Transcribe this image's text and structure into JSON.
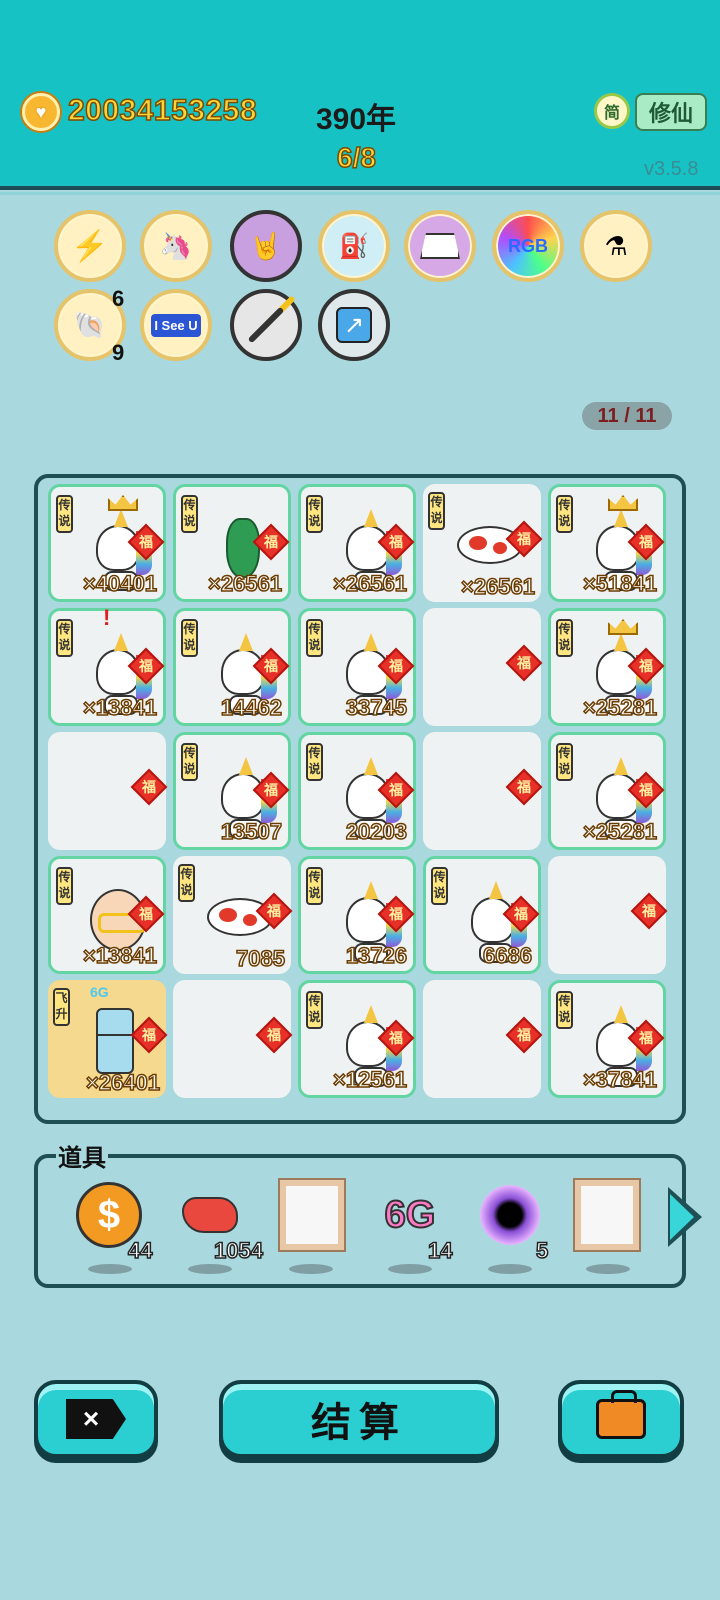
{
  "header": {
    "money": "20034153258",
    "year": "390年",
    "stage": "6/8",
    "simp_label": "简",
    "mode_label": "修仙",
    "version": "v3.5.8"
  },
  "badges": {
    "row1": [
      {
        "name": "lightning-badge",
        "icon": "⚡",
        "bg": "#fff1c2"
      },
      {
        "name": "unicorn-badge",
        "icon": "🦄",
        "bg": "#fff1c2"
      },
      {
        "name": "rock-hand-badge",
        "icon": "🤘",
        "bg": "#c8a0e0"
      },
      {
        "name": "pump-badge",
        "icon": "⛽",
        "bg": "#cfeef5"
      },
      {
        "name": "skirt-badge",
        "icon": "👗",
        "bg": "#d6a8e6"
      },
      {
        "name": "rgb-badge",
        "icon": "RGB",
        "bg": "#ff5f5f"
      },
      {
        "name": "potion-badge",
        "icon": "⚗",
        "bg": "#fff1c2"
      }
    ],
    "row2": [
      {
        "name": "shell-badge",
        "icon": "🐚",
        "bg": "#fff1c2"
      },
      {
        "name": "i-see-u-badge",
        "icon": "I See U",
        "bg": "#fff1c2"
      },
      {
        "name": "screwdriver-badge",
        "icon": "🪛",
        "bg": "#e6e6e6"
      },
      {
        "name": "arrow-badge",
        "icon": "↗",
        "bg": "#dfe8ea"
      }
    ],
    "shell_sup_top": "6",
    "shell_sup_bottom": "9"
  },
  "counter": "11 / 11",
  "board": {
    "tag_legend": "传说",
    "tag_ascend": "飞升",
    "fu": "福",
    "rows": [
      [
        {
          "item": "unicorn-crown",
          "count": "×40401",
          "tag": "传说",
          "filled": true
        },
        {
          "item": "vase",
          "count": "×26561",
          "tag": "传说",
          "filled": true
        },
        {
          "item": "unicorn",
          "count": "×26561",
          "tag": "传说",
          "filled": true
        },
        {
          "item": "fish",
          "count": "×26561",
          "tag": "传说",
          "filled": false
        },
        {
          "item": "unicorn-crown",
          "count": "×51841",
          "tag": "传说",
          "filled": true
        }
      ],
      [
        {
          "item": "unicorn-alert",
          "count": "×13841",
          "tag": "传说",
          "filled": true
        },
        {
          "item": "unicorn",
          "count": "14462",
          "tag": "传说",
          "filled": true
        },
        {
          "item": "unicorn",
          "count": "33745",
          "tag": "传说",
          "filled": true
        },
        {
          "item": "empty",
          "count": "",
          "tag": "",
          "filled": false
        },
        {
          "item": "unicorn-crown",
          "count": "×25281",
          "tag": "传说",
          "filled": true
        }
      ],
      [
        {
          "item": "empty",
          "count": "",
          "tag": "",
          "filled": false
        },
        {
          "item": "unicorn",
          "count": "13507",
          "tag": "传说",
          "filled": true
        },
        {
          "item": "unicorn",
          "count": "20203",
          "tag": "传说",
          "filled": true
        },
        {
          "item": "empty",
          "count": "",
          "tag": "",
          "filled": false
        },
        {
          "item": "unicorn",
          "count": "×25281",
          "tag": "传说",
          "filled": true
        }
      ],
      [
        {
          "item": "oldman",
          "count": "×13841",
          "tag": "传说",
          "filled": true
        },
        {
          "item": "fish",
          "count": "7085",
          "tag": "传说",
          "filled": false
        },
        {
          "item": "unicorn",
          "count": "13726",
          "tag": "传说",
          "filled": true
        },
        {
          "item": "unicorn",
          "count": "6686",
          "tag": "传说",
          "filled": true
        },
        {
          "item": "empty",
          "count": "",
          "tag": "",
          "filled": false
        }
      ],
      [
        {
          "item": "fridge",
          "count": "×26401",
          "tag": "飞升",
          "filled": false,
          "gold": true
        },
        {
          "item": "empty",
          "count": "",
          "tag": "",
          "filled": false
        },
        {
          "item": "unicorn",
          "count": "×12561",
          "tag": "传说",
          "filled": true
        },
        {
          "item": "empty",
          "count": "",
          "tag": "",
          "filled": false
        },
        {
          "item": "unicorn",
          "count": "×37841",
          "tag": "传说",
          "filled": true
        }
      ]
    ]
  },
  "items_panel": {
    "title": "道具",
    "props": [
      {
        "name": "dollar-coin",
        "count": "44"
      },
      {
        "name": "liver",
        "count": "1054"
      },
      {
        "name": "frame",
        "count": ""
      },
      {
        "name": "6g",
        "label": "6G",
        "count": "14"
      },
      {
        "name": "black-hole",
        "count": "5"
      },
      {
        "name": "frame",
        "count": ""
      }
    ]
  },
  "buttons": {
    "close_icon": "×",
    "settle_label": "结算"
  }
}
